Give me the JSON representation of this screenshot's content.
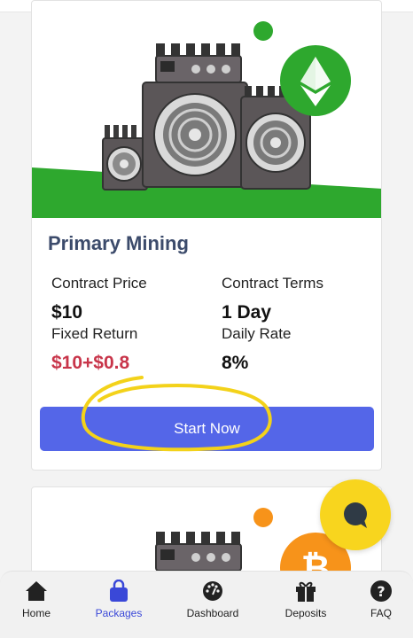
{
  "package": {
    "title": "Primary Mining",
    "contract_price_label": "Contract Price",
    "contract_price_value": "$10",
    "contract_terms_label": "Contract Terms",
    "contract_terms_value": "1 Day",
    "fixed_return_label": "Fixed Return",
    "fixed_return_value": "$10+$0.8",
    "daily_rate_label": "Daily Rate",
    "daily_rate_value": "8%",
    "button_label": "Start Now"
  },
  "icons": {
    "card1_coin": "ethereum-icon",
    "card2_coin": "bitcoin-icon",
    "chat": "chat-icon"
  },
  "nav": {
    "items": [
      {
        "label": "Home",
        "icon": "home-icon"
      },
      {
        "label": "Packages",
        "icon": "shopping-bag-icon",
        "active": true
      },
      {
        "label": "Dashboard",
        "icon": "gauge-icon"
      },
      {
        "label": "Deposits",
        "icon": "gift-icon"
      },
      {
        "label": "FAQ",
        "icon": "question-icon"
      }
    ]
  },
  "colors": {
    "accent": "#5466e8",
    "price_red": "#c8354a",
    "green": "#2ea82e",
    "highlight_yellow": "#f3d21a",
    "bitcoin_orange": "#f7931a",
    "title_navy": "#3c4b6b"
  }
}
